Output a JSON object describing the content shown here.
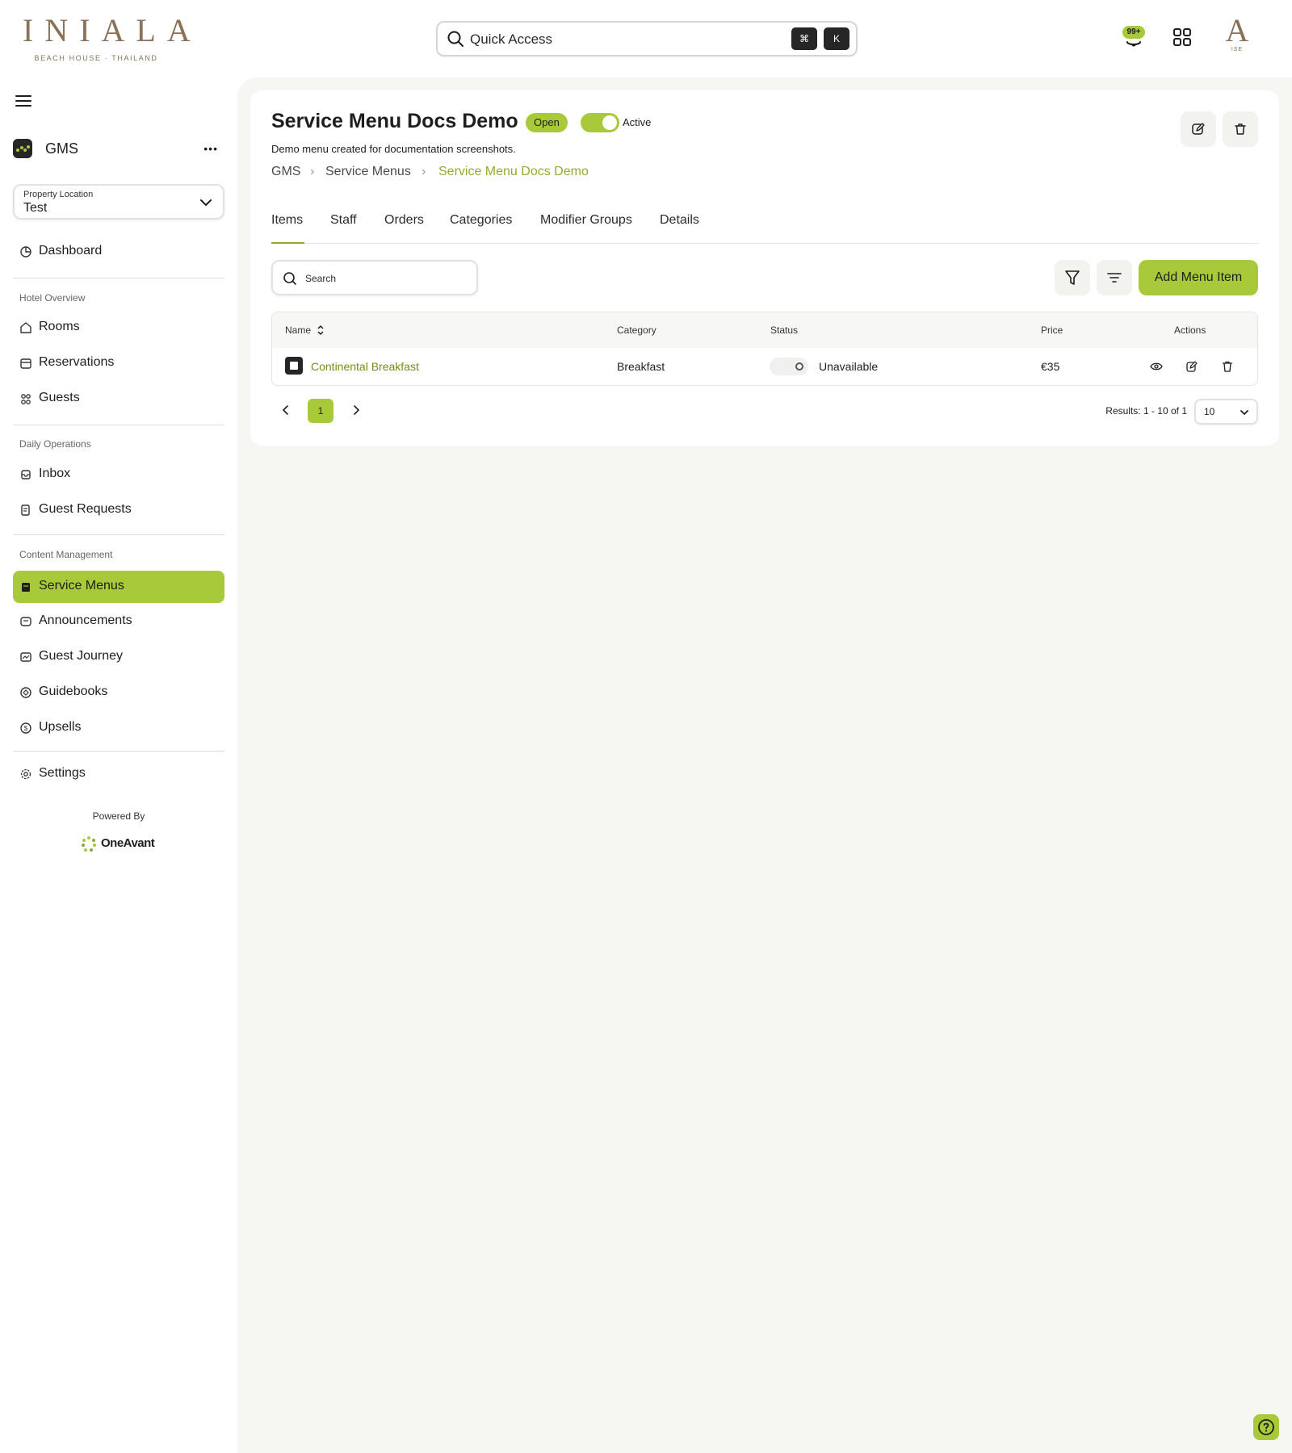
{
  "brand": {
    "logo_main": "INIALA",
    "logo_sub": "BEACH HOUSE · THAILAND"
  },
  "topbar": {
    "quick_access_label": "Quick Access",
    "kbd_cmd": "⌘",
    "kbd_k": "K",
    "notification_count": "99+",
    "avatar_letter": "A",
    "avatar_sub": "ISE"
  },
  "sidebar": {
    "app_name": "GMS",
    "more_label": "•••",
    "property_label": "Property Location",
    "property_value": "Test",
    "dashboard": "Dashboard",
    "sections": {
      "hotel_overview": "Hotel Overview",
      "daily_operations": "Daily Operations",
      "content_management": "Content Management"
    },
    "items": {
      "rooms": "Rooms",
      "reservations": "Reservations",
      "guests": "Guests",
      "inbox": "Inbox",
      "guest_requests": "Guest Requests",
      "service_menus": "Service Menus",
      "announcements": "Announcements",
      "guest_journey": "Guest Journey",
      "guidebooks": "Guidebooks",
      "upsells": "Upsells",
      "settings": "Settings"
    },
    "powered_by": "Powered By",
    "powered_brand": "OneAvant"
  },
  "page": {
    "title": "Service Menu Docs Demo",
    "status_badge": "Open",
    "active_label": "Active",
    "active": true,
    "description": "Demo menu created for documentation screenshots.",
    "breadcrumb": [
      "GMS",
      "Service Menus",
      "Service Menu Docs Demo"
    ]
  },
  "tabs": [
    "Items",
    "Staff",
    "Orders",
    "Categories",
    "Modifier Groups",
    "Details"
  ],
  "active_tab": "Items",
  "toolbar": {
    "search_placeholder": "Search",
    "add_label": "Add Menu Item"
  },
  "table": {
    "columns": [
      "Name",
      "Category",
      "Status",
      "Price",
      "Actions"
    ],
    "rows": [
      {
        "name": "Continental Breakfast",
        "category": "Breakfast",
        "status": "Unavailable",
        "available": false,
        "price": "€35"
      }
    ]
  },
  "pagination": {
    "current_page": "1",
    "results": "Results: 1 - 10 of 1",
    "per_page": "10"
  },
  "colors": {
    "accent": "#a8c93a",
    "accent_text": "#8fad2c",
    "brand": "#8a7259",
    "background": "#f6f6f3"
  }
}
